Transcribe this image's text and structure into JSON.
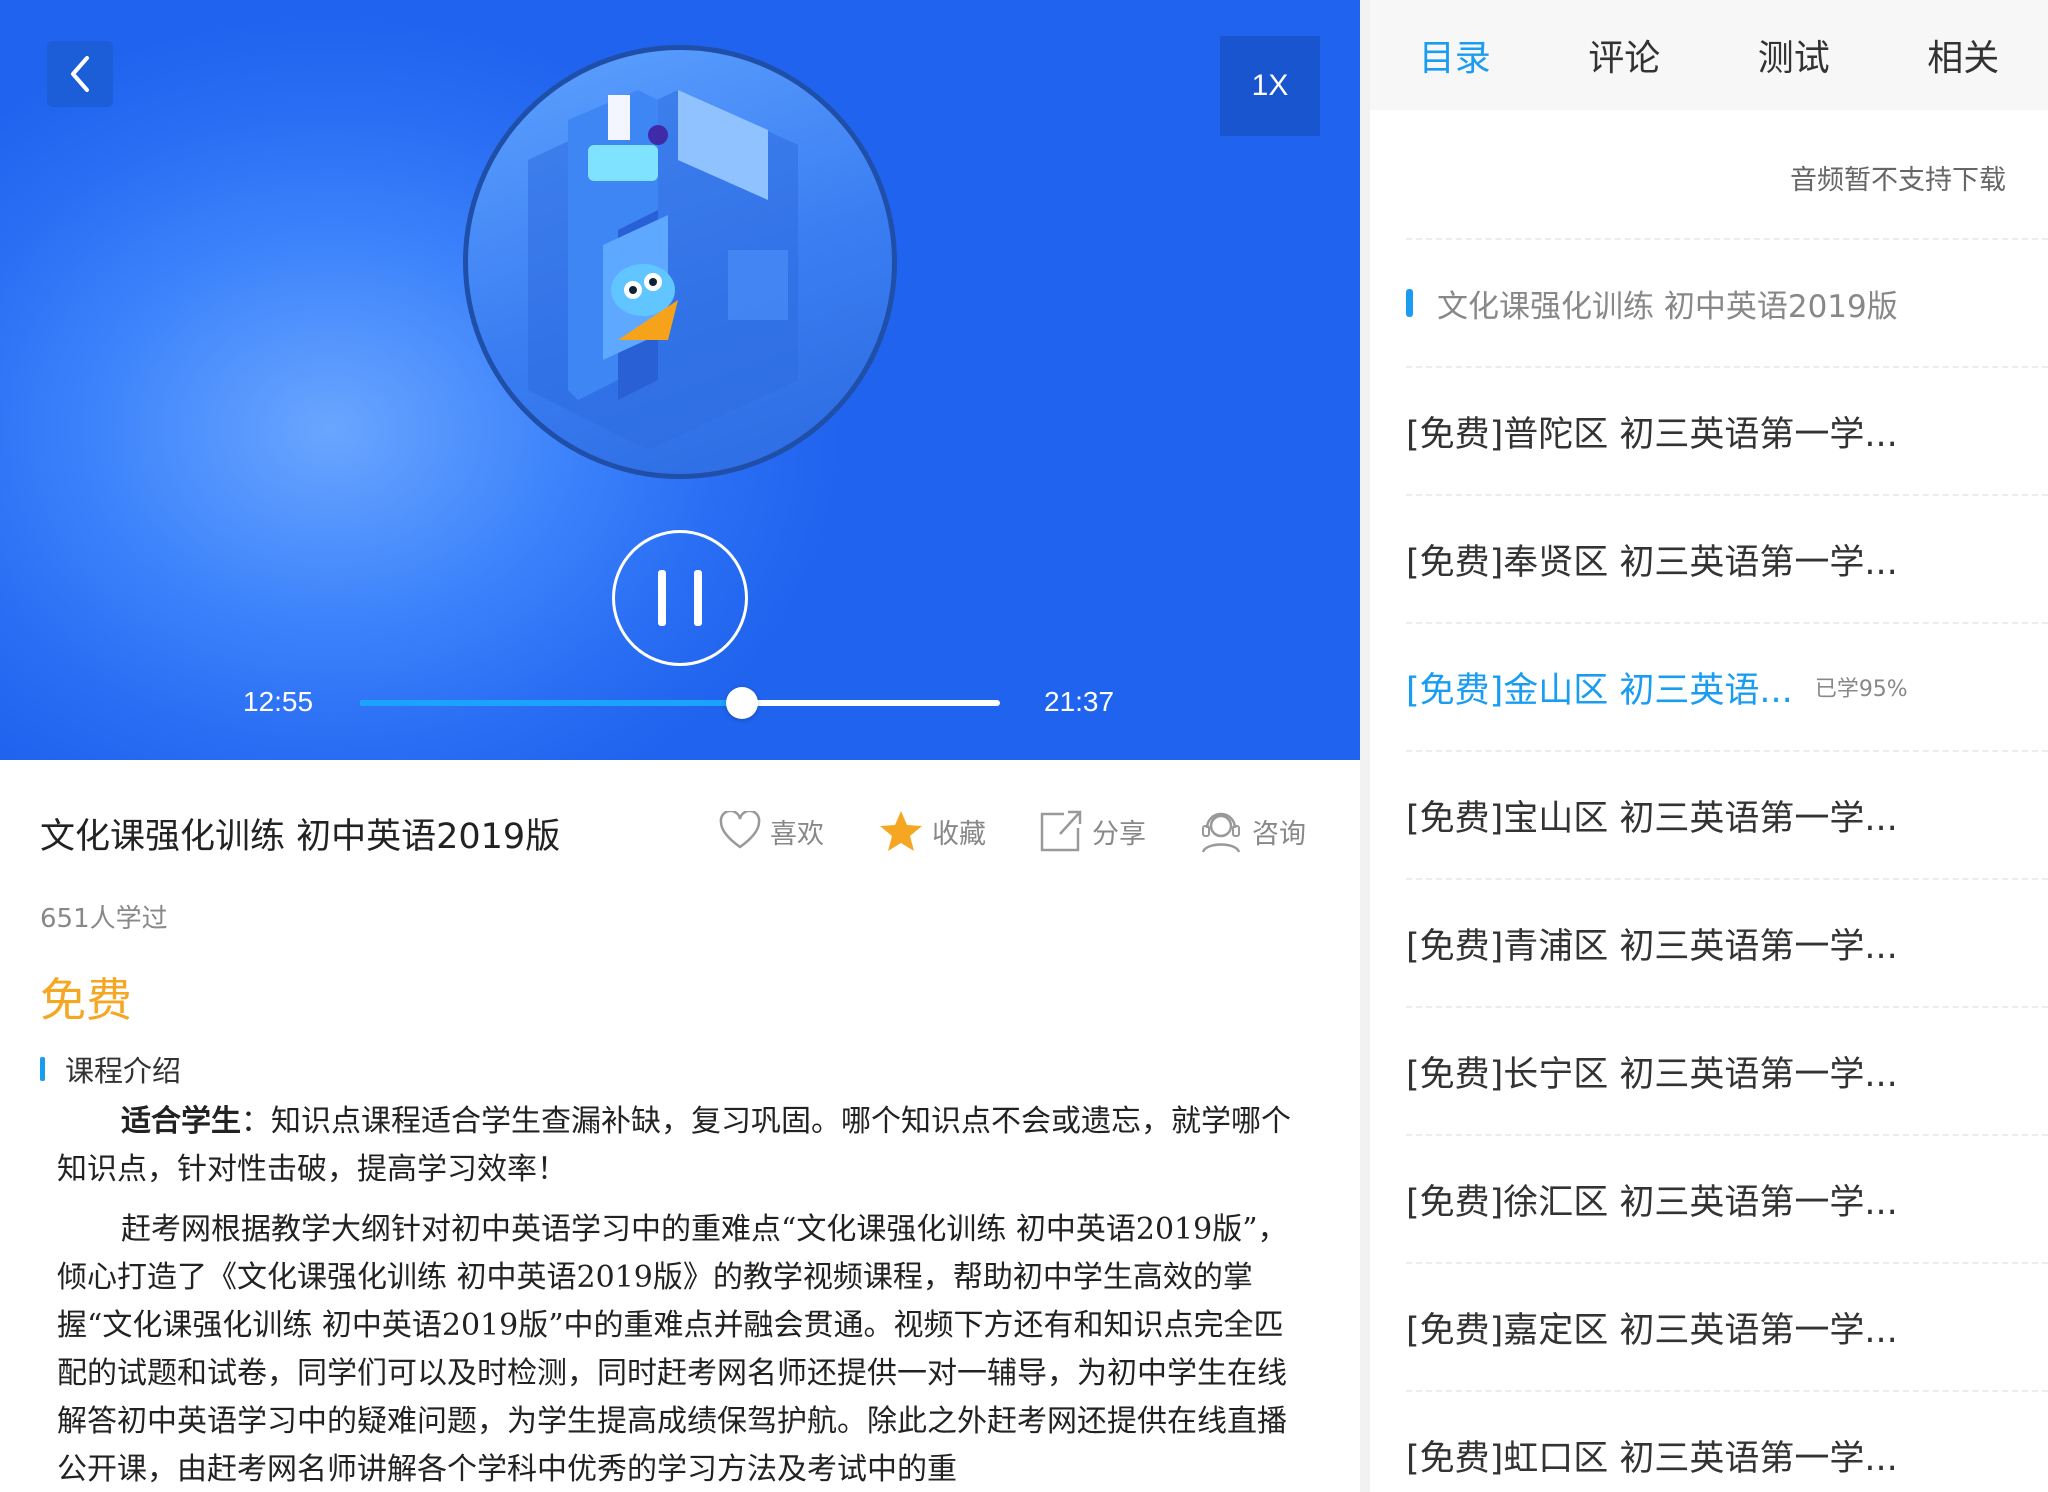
{
  "player": {
    "speed": "1X",
    "current_time": "12:55",
    "total_time": "21:37",
    "progress": 0.597
  },
  "course": {
    "title": "文化课强化训练 初中英语2019版",
    "learners": "651人学过",
    "price": "免费",
    "section_title": "课程介绍",
    "paragraph1_bold": "适合学生",
    "paragraph1": "：知识点课程适合学生查漏补缺，复习巩固。哪个知识点不会或遗忘，就学哪个知识点，针对性击破，提高学习效率！",
    "paragraph2": "赶考网根据教学大纲针对初中英语学习中的重难点“文化课强化训练 初中英语2019版”，倾心打造了《文化课强化训练 初中英语2019版》的教学视频课程，帮助初中学生高效的掌握“文化课强化训练 初中英语2019版”中的重难点并融会贯通。视频下方还有和知识点完全匹配的试题和试卷，同学们可以及时检测，同时赶考网名师还提供一对一辅导，为初中学生在线解答初中英语学习中的疑难问题，为学生提高成绩保驾护航。除此之外赶考网还提供在线直播公开课，由赶考网名师讲解各个学科中优秀的学习方法及考试中的重"
  },
  "actions": {
    "like": "喜欢",
    "favorite": "收藏",
    "share": "分享",
    "consult": "咨询"
  },
  "tabs": [
    "目录",
    "评论",
    "测试",
    "相关"
  ],
  "catalog": {
    "notice": "音频暂不支持下载",
    "header": "文化课强化训练 初中英语2019版",
    "items": [
      {
        "label": "[免费]普陀区 初三英语第一学..."
      },
      {
        "label": "[免费]奉贤区 初三英语第一学..."
      },
      {
        "label": "[免费]金山区 初三英语...",
        "progress": "已学95%",
        "current": true
      },
      {
        "label": "[免费]宝山区 初三英语第一学..."
      },
      {
        "label": "[免费]青浦区 初三英语第一学..."
      },
      {
        "label": "[免费]长宁区 初三英语第一学..."
      },
      {
        "label": "[免费]徐汇区 初三英语第一学..."
      },
      {
        "label": "[免费]嘉定区 初三英语第一学..."
      },
      {
        "label": "[免费]虹口区 初三英语第一学..."
      }
    ]
  },
  "colors": {
    "accent": "#1a9cf0",
    "price": "#f5a623",
    "player_bg": "#2f76f6"
  }
}
